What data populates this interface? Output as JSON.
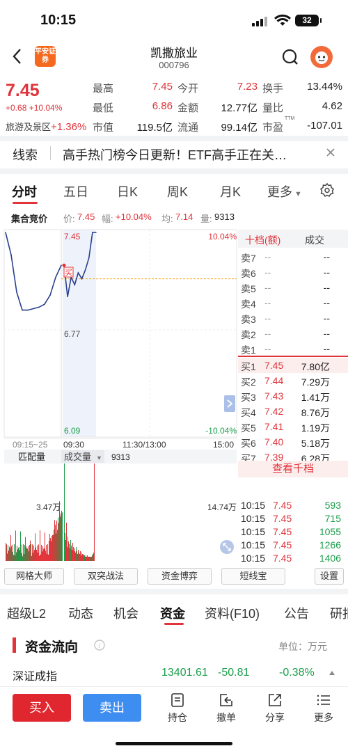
{
  "status": {
    "time": "10:15",
    "battery": "32"
  },
  "nav": {
    "broker_logo": "平安证券",
    "stock_name": "凯撒旅业",
    "stock_code": "000796"
  },
  "quote": {
    "price": "7.45",
    "change": "+0.68 +10.04%",
    "sector": "旅游及景区",
    "sector_change": "+1.36%",
    "rows": [
      [
        {
          "label": "最高",
          "value": "7.45",
          "color": "red"
        },
        {
          "label": "今开",
          "value": "7.23",
          "color": "red"
        },
        {
          "label": "换手",
          "value": "13.44%",
          "color": "dark"
        }
      ],
      [
        {
          "label": "最低",
          "value": "6.86",
          "color": "red"
        },
        {
          "label": "金额",
          "value": "12.77亿",
          "color": "dark"
        },
        {
          "label": "量比",
          "value": "4.62",
          "color": "dark"
        }
      ],
      [
        {
          "label": "市值",
          "value": "119.5亿",
          "color": "dark"
        },
        {
          "label": "流通",
          "value": "99.14亿",
          "color": "dark"
        },
        {
          "label": "市盈",
          "value": "-107.01",
          "color": "dark"
        }
      ]
    ],
    "pe_sup": "TTM"
  },
  "news": {
    "tag": "线索",
    "text": "高手热门榜今日更新！ETF高手正在关…"
  },
  "chart_tabs": [
    "分时",
    "五日",
    "日K",
    "周K",
    "月K",
    "更多"
  ],
  "auction": {
    "label": "集合竞价",
    "price_label": "价:",
    "price": "7.45",
    "range_label": "幅:",
    "range": "+10.04%",
    "avg_label": "均:",
    "avg": "7.14",
    "vol_label": "量:",
    "vol": "9313"
  },
  "chart": {
    "y_high": "7.45",
    "y_mid": "6.77",
    "y_low": "6.09",
    "pct_high": "10.04%",
    "pct_low": "-10.04%",
    "buy_marker": "买",
    "x_labels": [
      "09:15~25",
      "09:30",
      "11:30/13:00",
      "15:00"
    ],
    "vol_tabs": [
      "匹配量",
      "成交量"
    ],
    "vol_value": "9313",
    "vol_left": "3.47万",
    "vol_right": "14.74万"
  },
  "chart_data": {
    "type": "line",
    "title": "",
    "x": [
      "09:15",
      "09:16",
      "09:17",
      "09:18",
      "09:19",
      "09:20",
      "09:21",
      "09:22",
      "09:23",
      "09:24",
      "09:25",
      "09:30",
      "09:35",
      "09:40",
      "09:45",
      "09:50",
      "09:55",
      "10:00",
      "10:05",
      "10:10",
      "10:15"
    ],
    "series": [
      {
        "name": "",
        "values": [
          7.45,
          7.3,
          7.05,
          6.93,
          6.93,
          6.94,
          6.95,
          6.97,
          7.03,
          7.15,
          7.23,
          7.23,
          7.02,
          7.15,
          7.1,
          7.18,
          7.14,
          7.2,
          7.28,
          7.45,
          7.45
        ]
      }
    ],
    "ylim": [
      6.09,
      7.45
    ],
    "avg_line": 7.14
  },
  "orderbook": {
    "header_left": "十档(额)",
    "header_right": "成交",
    "asks": [
      {
        "label": "卖7",
        "price": "--",
        "amt": "--"
      },
      {
        "label": "卖6",
        "price": "--",
        "amt": "--"
      },
      {
        "label": "卖5",
        "price": "--",
        "amt": "--"
      },
      {
        "label": "卖4",
        "price": "--",
        "amt": "--"
      },
      {
        "label": "卖3",
        "price": "--",
        "amt": "--"
      },
      {
        "label": "卖2",
        "price": "--",
        "amt": "--"
      },
      {
        "label": "卖1",
        "price": "--",
        "amt": "--"
      }
    ],
    "bids": [
      {
        "label": "买1",
        "price": "7.45",
        "amt": "7.80亿"
      },
      {
        "label": "买2",
        "price": "7.44",
        "amt": "7.29万"
      },
      {
        "label": "买3",
        "price": "7.43",
        "amt": "1.41万"
      },
      {
        "label": "买4",
        "price": "7.42",
        "amt": "8.76万"
      },
      {
        "label": "买5",
        "price": "7.41",
        "amt": "1.19万"
      },
      {
        "label": "买6",
        "price": "7.40",
        "amt": "5.18万"
      },
      {
        "label": "买7",
        "price": "7.39",
        "amt": "6.28万"
      }
    ],
    "more": "查看千档",
    "trades": [
      {
        "time": "10:15",
        "price": "7.45",
        "vol": "593"
      },
      {
        "time": "10:15",
        "price": "7.45",
        "vol": "715"
      },
      {
        "time": "10:15",
        "price": "7.45",
        "vol": "1055"
      },
      {
        "time": "10:15",
        "price": "7.45",
        "vol": "1266"
      },
      {
        "time": "10:15",
        "price": "7.45",
        "vol": "1406"
      }
    ]
  },
  "tools": [
    "网格大师",
    "双突战法",
    "资金博弈",
    "短线宝",
    "设置"
  ],
  "bottom_tabs": [
    "超级L2",
    "动态",
    "机会",
    "资金",
    "资料(F10)",
    "公告",
    "研报"
  ],
  "flow": {
    "title": "资金流向",
    "unit": "单位：万元",
    "index_name": "深证成指",
    "index_value": "13401.61",
    "index_change": "-50.81",
    "index_pct": "-0.38%"
  },
  "actions": {
    "buy": "买入",
    "sell": "卖出",
    "items": [
      "持仓",
      "撤单",
      "分享",
      "更多"
    ]
  },
  "colors": {
    "up": "#e0333a",
    "down": "#1a9e4a",
    "line": "#2b3f8f",
    "avg": "#f2a31b",
    "buy_btn": "#e0262e",
    "sell_btn": "#3d8ef0"
  }
}
